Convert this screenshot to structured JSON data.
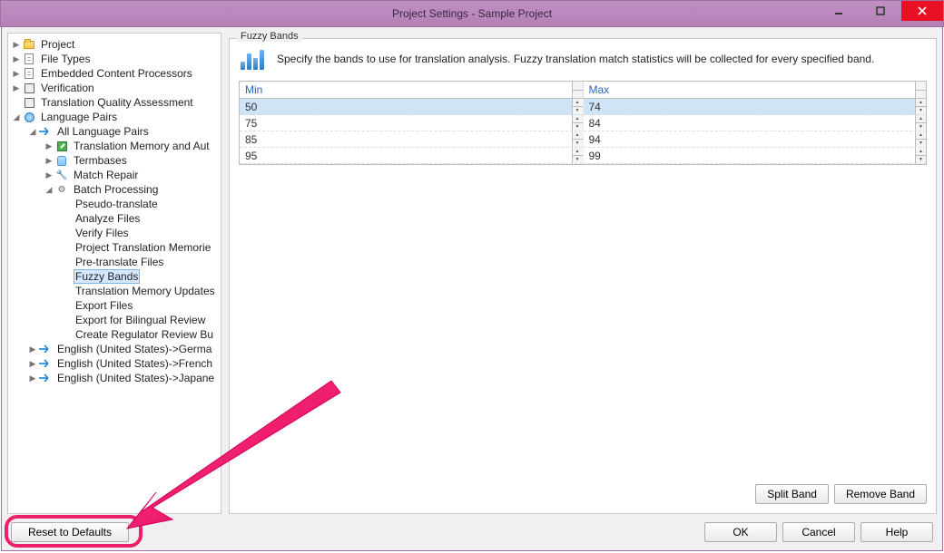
{
  "window": {
    "title": "Project Settings - Sample Project"
  },
  "tree": {
    "project": "Project",
    "file_types": "File Types",
    "embedded_content": "Embedded Content Processors",
    "verification": "Verification",
    "tqa": "Translation Quality Assessment",
    "language_pairs": "Language Pairs",
    "all_lang_pairs": "All Language Pairs",
    "tm_auto": "Translation Memory and Aut",
    "termbases": "Termbases",
    "match_repair": "Match Repair",
    "batch_processing": "Batch Processing",
    "bp": {
      "pseudo": "Pseudo-translate",
      "analyze": "Analyze Files",
      "verify": "Verify Files",
      "ptm": "Project Translation Memorie",
      "pretranslate": "Pre-translate Files",
      "fuzzy": "Fuzzy Bands",
      "tm_updates": "Translation Memory Updates",
      "export": "Export Files",
      "export_bl": "Export for Bilingual Review",
      "create_reg": "Create Regulator Review Bu"
    },
    "en_de": "English (United States)->Germa",
    "en_fr": "English (United States)->French",
    "en_ja": "English (United States)->Japane"
  },
  "content": {
    "group_title": "Fuzzy Bands",
    "description": "Specify the bands to use for translation analysis. Fuzzy translation match statistics will be collected for every specified band.",
    "headers": {
      "min": "Min",
      "max": "Max"
    },
    "rows": [
      {
        "min": "50",
        "max": "74",
        "selected": true
      },
      {
        "min": "75",
        "max": "84",
        "selected": false
      },
      {
        "min": "85",
        "max": "94",
        "selected": false
      },
      {
        "min": "95",
        "max": "99",
        "selected": false
      }
    ],
    "split_band": "Split Band",
    "remove_band": "Remove Band"
  },
  "footer": {
    "reset": "Reset to Defaults",
    "ok": "OK",
    "cancel": "Cancel",
    "help": "Help"
  }
}
